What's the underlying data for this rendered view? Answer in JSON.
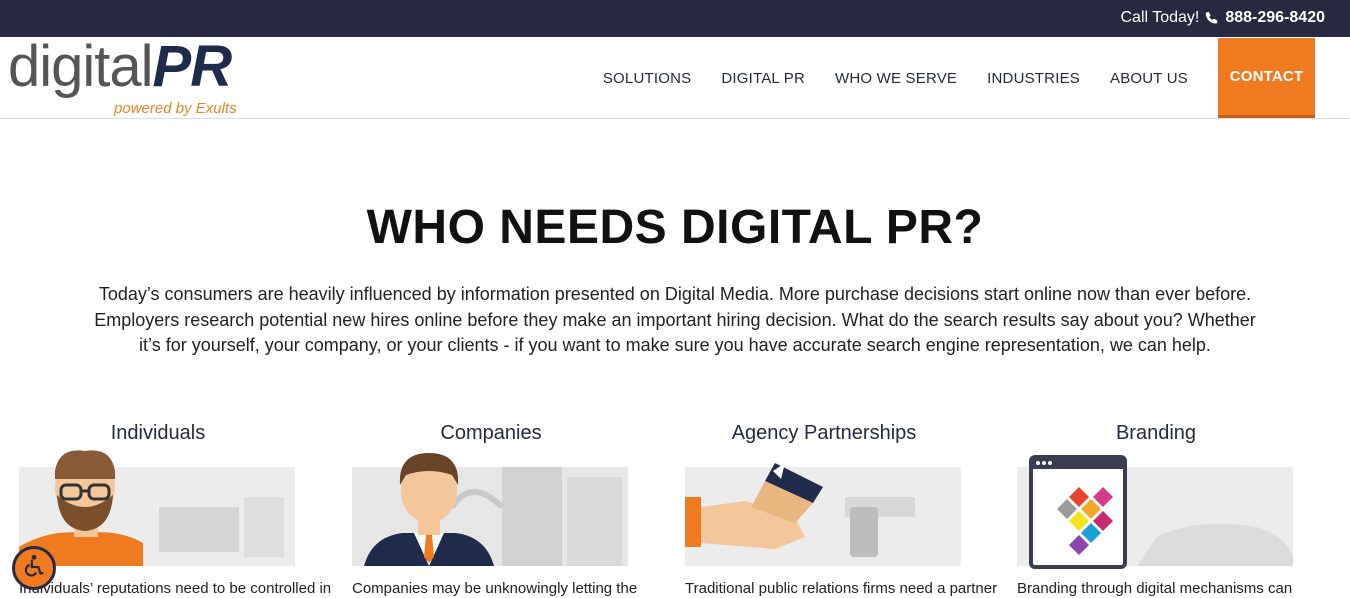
{
  "topbar": {
    "call_label": "Call Today!",
    "phone": "888-296-8420"
  },
  "logo": {
    "light": "digital",
    "bold": "PR",
    "tagline": "powered by Exults"
  },
  "nav": {
    "items": [
      "SOLUTIONS",
      "DIGITAL PR",
      "WHO WE SERVE",
      "INDUSTRIES",
      "ABOUT US"
    ],
    "contact": "CONTACT"
  },
  "hero": {
    "title": "WHO NEEDS DIGITAL PR?",
    "text": "Today’s consumers are heavily influenced by information presented on Digital Media. More purchase decisions start online now than ever before. Employers research potential new hires online before they make an important hiring decision. What do the search results say about you? Whether it’s for yourself, your company, or your clients - if you want to make sure you have accurate search engine representation, we can help."
  },
  "cards": [
    {
      "title": "Individuals",
      "desc": "Individuals’ reputations need to be controlled in"
    },
    {
      "title": "Companies",
      "desc": "Companies may be unknowingly letting the"
    },
    {
      "title": "Agency Partnerships",
      "desc": "Traditional public relations firms need a partner"
    },
    {
      "title": "Branding",
      "desc": "Branding through digital mechanisms can"
    }
  ],
  "colors": {
    "topbar": "#262940",
    "accent": "#f07a1f",
    "navy": "#1f2b4a"
  },
  "icons": {
    "phone": "phone-icon",
    "accessibility": "accessibility-icon"
  }
}
